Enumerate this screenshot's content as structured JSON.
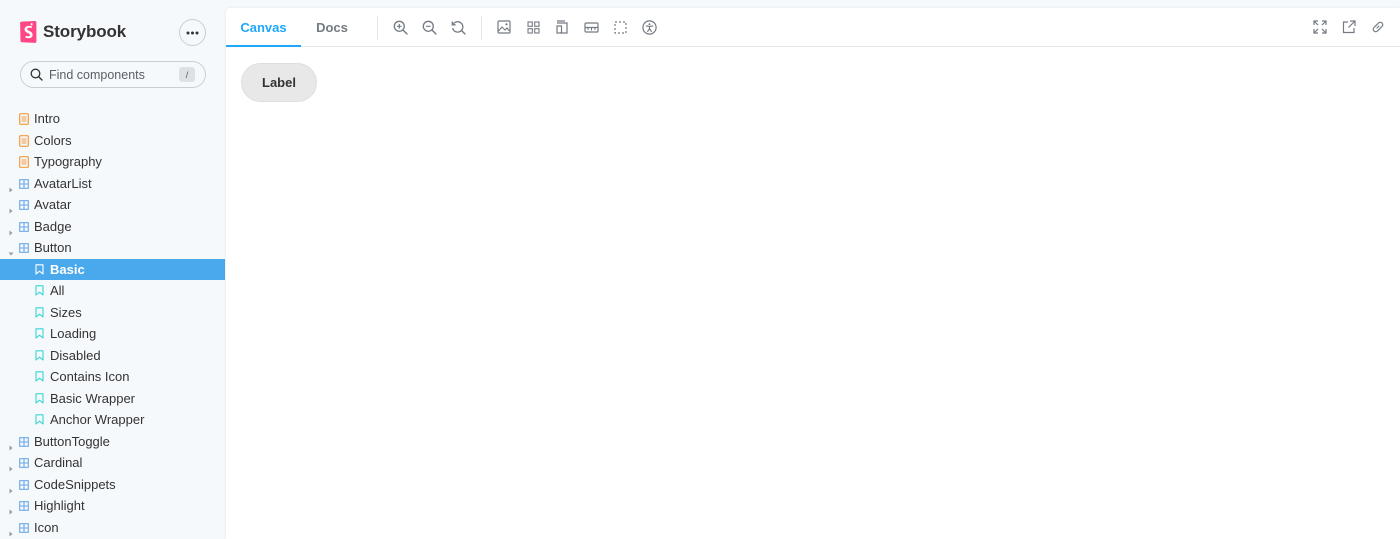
{
  "brand": {
    "name": "Storybook",
    "accent": "#ff4785"
  },
  "search": {
    "placeholder": "Find components",
    "shortcut": "/"
  },
  "tree": [
    {
      "label": "Intro",
      "kind": "doc"
    },
    {
      "label": "Colors",
      "kind": "doc"
    },
    {
      "label": "Typography",
      "kind": "doc"
    },
    {
      "label": "AvatarList",
      "kind": "component",
      "expanded": false
    },
    {
      "label": "Avatar",
      "kind": "component",
      "expanded": false
    },
    {
      "label": "Badge",
      "kind": "component",
      "expanded": false
    },
    {
      "label": "Button",
      "kind": "component",
      "expanded": true
    },
    {
      "label": "Basic",
      "kind": "story",
      "selected": true
    },
    {
      "label": "All",
      "kind": "story"
    },
    {
      "label": "Sizes",
      "kind": "story"
    },
    {
      "label": "Loading",
      "kind": "story"
    },
    {
      "label": "Disabled",
      "kind": "story"
    },
    {
      "label": "Contains Icon",
      "kind": "story"
    },
    {
      "label": "Basic Wrapper",
      "kind": "story"
    },
    {
      "label": "Anchor Wrapper",
      "kind": "story"
    },
    {
      "label": "ButtonToggle",
      "kind": "component",
      "expanded": false
    },
    {
      "label": "Cardinal",
      "kind": "component",
      "expanded": false
    },
    {
      "label": "CodeSnippets",
      "kind": "component",
      "expanded": false
    },
    {
      "label": "Highlight",
      "kind": "component",
      "expanded": false
    },
    {
      "label": "Icon",
      "kind": "component",
      "expanded": false
    }
  ],
  "toolbar": {
    "tabs": [
      {
        "label": "Canvas",
        "active": true
      },
      {
        "label": "Docs",
        "active": false
      }
    ],
    "tools_left": [
      "zoom-in-icon",
      "zoom-out-icon",
      "zoom-reset-icon"
    ],
    "tools_addons": [
      "background-image-icon",
      "grid-icon",
      "viewport-icon",
      "measure-ruler-icon",
      "outline-icon",
      "accessibility-icon"
    ],
    "tools_right": [
      "fullscreen-icon",
      "open-new-tab-icon",
      "copy-link-icon"
    ]
  },
  "canvas": {
    "button_label": "Label"
  },
  "colors": {
    "selected_bg": "#4aa8ec",
    "active_tab": "#1ea7fd",
    "doc_icon": "#f29c40",
    "component_icon": "#6aa9e6",
    "story_icon": "#37d5d3"
  }
}
